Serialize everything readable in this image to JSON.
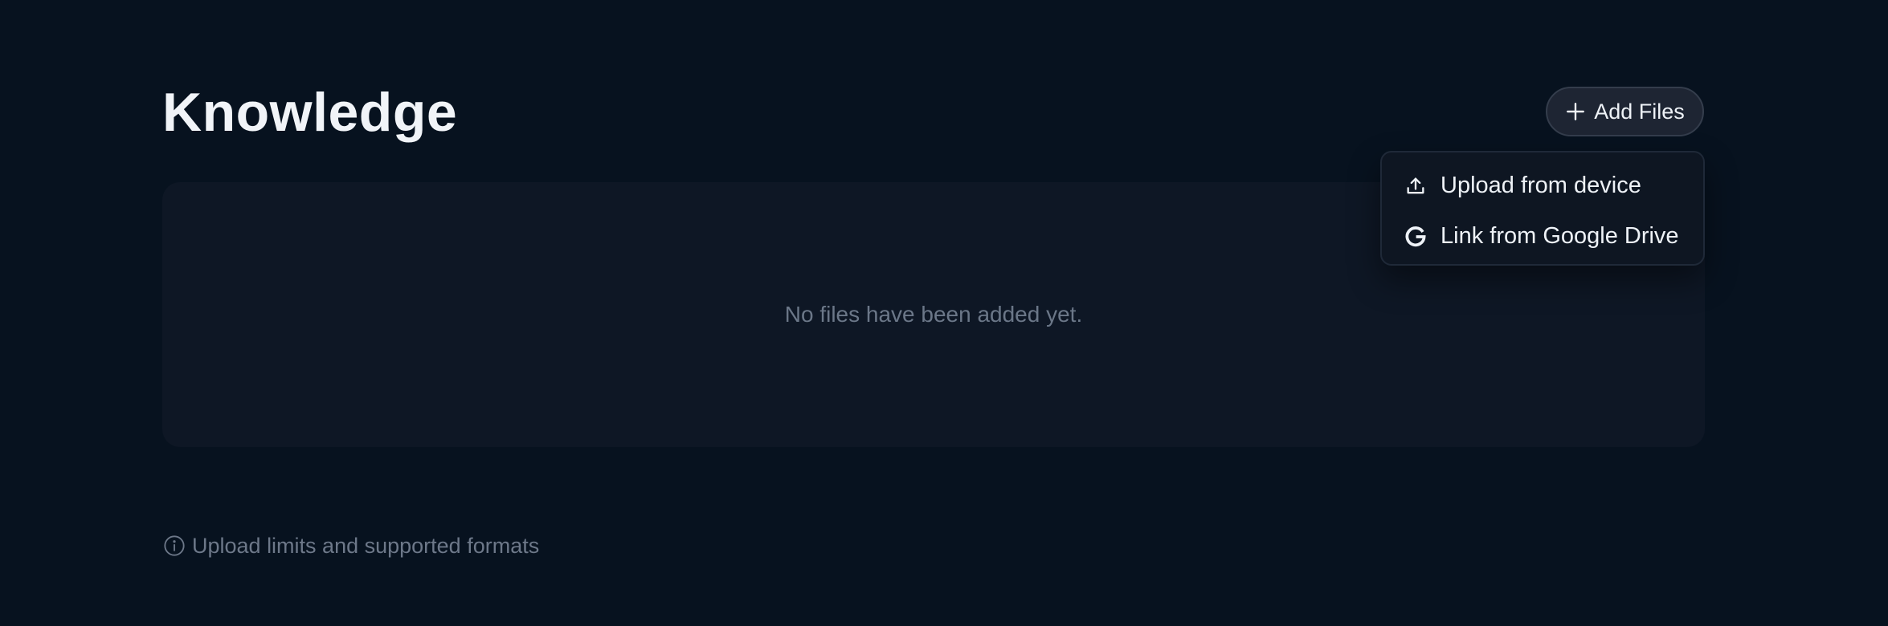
{
  "header": {
    "title": "Knowledge",
    "add_files_label": "Add Files",
    "add_files_icon": "plus-icon"
  },
  "dropdown": {
    "items": [
      {
        "label": "Upload from device",
        "icon": "upload-icon"
      },
      {
        "label": "Link from Google Drive",
        "icon": "google-drive-icon"
      }
    ]
  },
  "empty_state": {
    "message": "No files have been added yet."
  },
  "footer": {
    "info_label": "Upload limits and supported formats",
    "info_icon": "info-icon"
  },
  "colors": {
    "background": "#07121f",
    "panel": "#0e1725",
    "button": "#1e2533",
    "muted_text": "#6b7788",
    "primary_text": "#eef2f7"
  }
}
